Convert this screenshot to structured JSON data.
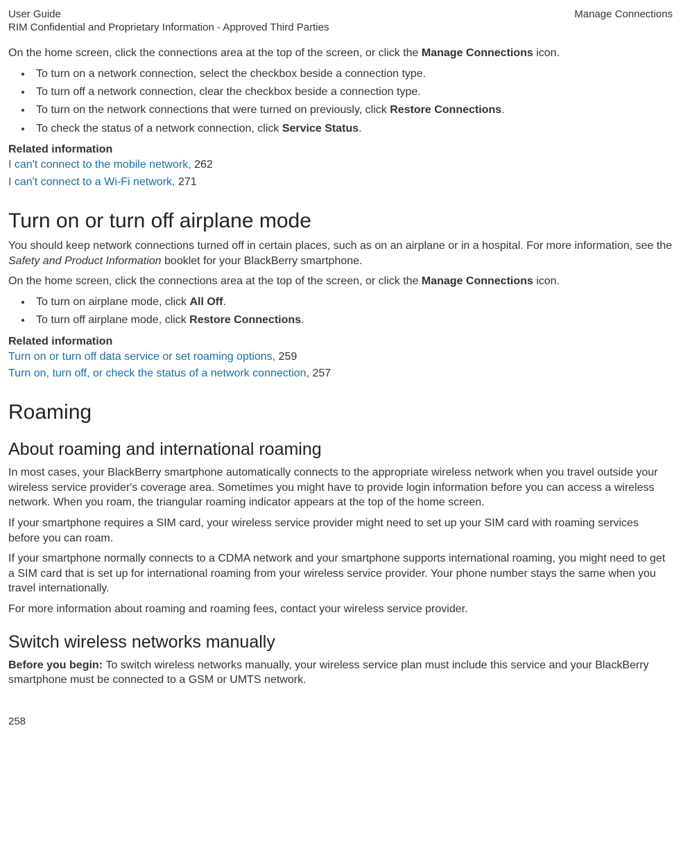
{
  "header": {
    "leftTop": "User Guide",
    "leftBottom": "RIM Confidential and Proprietary Information - Approved Third Parties",
    "right": "Manage Connections"
  },
  "intro": {
    "prefix": "On the home screen, click the connections area at the top of the screen, or click the ",
    "bold": "Manage Connections",
    "suffix": " icon."
  },
  "list1": {
    "item1": "To turn on a network connection, select the checkbox beside a connection type.",
    "item2": "To turn off a network connection, clear the checkbox beside a connection type.",
    "item3a": "To turn on the network connections that were turned on previously, click ",
    "item3bold": "Restore Connections",
    "item3b": ".",
    "item4a": "To check the status of a network connection, click ",
    "item4bold": "Service Status",
    "item4b": "."
  },
  "relatedHeading": "Related information",
  "related1": {
    "link1": "I can't connect to the mobile network,",
    "page1": " 262",
    "link2": "I can't connect to a Wi-Fi network,",
    "page2": " 271"
  },
  "h1a": "Turn on or turn off airplane mode",
  "airplane": {
    "para1a": "You should keep network connections turned off in certain places, such as on an airplane or in a hospital. For more information, see the ",
    "para1italic": "Safety and Product Information",
    "para1b": " booklet for your BlackBerry smartphone.",
    "para2a": "On the home screen, click the connections area at the top of the screen, or click the ",
    "para2bold": "Manage Connections",
    "para2b": " icon."
  },
  "list2": {
    "item1a": "To turn on airplane mode, click ",
    "item1bold": "All Off",
    "item1b": ".",
    "item2a": "To turn off airplane mode, click ",
    "item2bold": "Restore Connections",
    "item2b": "."
  },
  "related2": {
    "link1": "Turn on or turn off data service or set roaming options,",
    "page1": " 259",
    "link2": "Turn on, turn off, or check the status of a network connection,",
    "page2": " 257"
  },
  "h1b": "Roaming",
  "h2a": "About roaming and international roaming",
  "roaming": {
    "p1": "In most cases, your BlackBerry smartphone automatically connects to the appropriate wireless network when you travel outside your wireless service provider's coverage area. Sometimes you might have to provide login information before you can access a wireless network. When you roam, the triangular roaming indicator appears at the top of the home screen.",
    "p2": "If your smartphone requires a SIM card, your wireless service provider might need to set up your SIM card with roaming services before you can roam.",
    "p3": "If your smartphone normally connects to a CDMA network and your smartphone supports international roaming, you might need to get a SIM card that is set up for international roaming from your wireless service provider. Your phone number stays the same when you travel internationally.",
    "p4": "For more information about roaming and roaming fees, contact your wireless service provider."
  },
  "h2b": "Switch wireless networks manually",
  "switch": {
    "bold": "Before you begin: ",
    "text": "To switch wireless networks manually, your wireless service plan must include this service and your BlackBerry smartphone must be connected to a GSM or UMTS network."
  },
  "pageNumber": "258"
}
